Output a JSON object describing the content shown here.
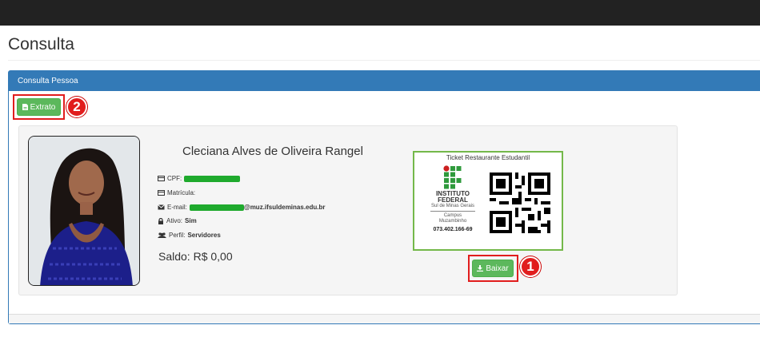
{
  "page": {
    "title": "Consulta"
  },
  "panel": {
    "heading": "Consulta Pessoa"
  },
  "actions": {
    "extrato_label": "Extrato",
    "baixar_label": "Baixar"
  },
  "annotations": {
    "marker_1": "1",
    "marker_2": "2"
  },
  "person": {
    "name": "Cleciana Alves de Oliveira Rangel",
    "cpf_label": "CPF:",
    "matricula_label": "Matrícula:",
    "email_label": "E-mail:",
    "email_domain": "@muz.ifsuldeminas.edu.br",
    "ativo_label": "Ativo:",
    "ativo_value": "Sim",
    "perfil_label": "Perfil:",
    "perfil_value": "Servidores",
    "saldo": "Saldo: R$ 0,00"
  },
  "ticket": {
    "title": "Ticket Restaurante Estudantil",
    "institute_line1": "INSTITUTO",
    "institute_line2": "FEDERAL",
    "institute_line3": "Sul de Minas Gerais",
    "campus_line1": "Campus",
    "campus_line2": "Muzambinho",
    "number": "073.402.166-69"
  },
  "colors": {
    "topbar": "#222222",
    "primary": "#337ab7",
    "success": "#5cb85c",
    "annotation": "#e11d1d",
    "redaction": "#1faa2d",
    "ticket_border": "#74b84a"
  },
  "icons": [
    "file-icon",
    "download-icon",
    "id-card-icon",
    "envelope-icon",
    "lock-icon",
    "users-icon"
  ]
}
